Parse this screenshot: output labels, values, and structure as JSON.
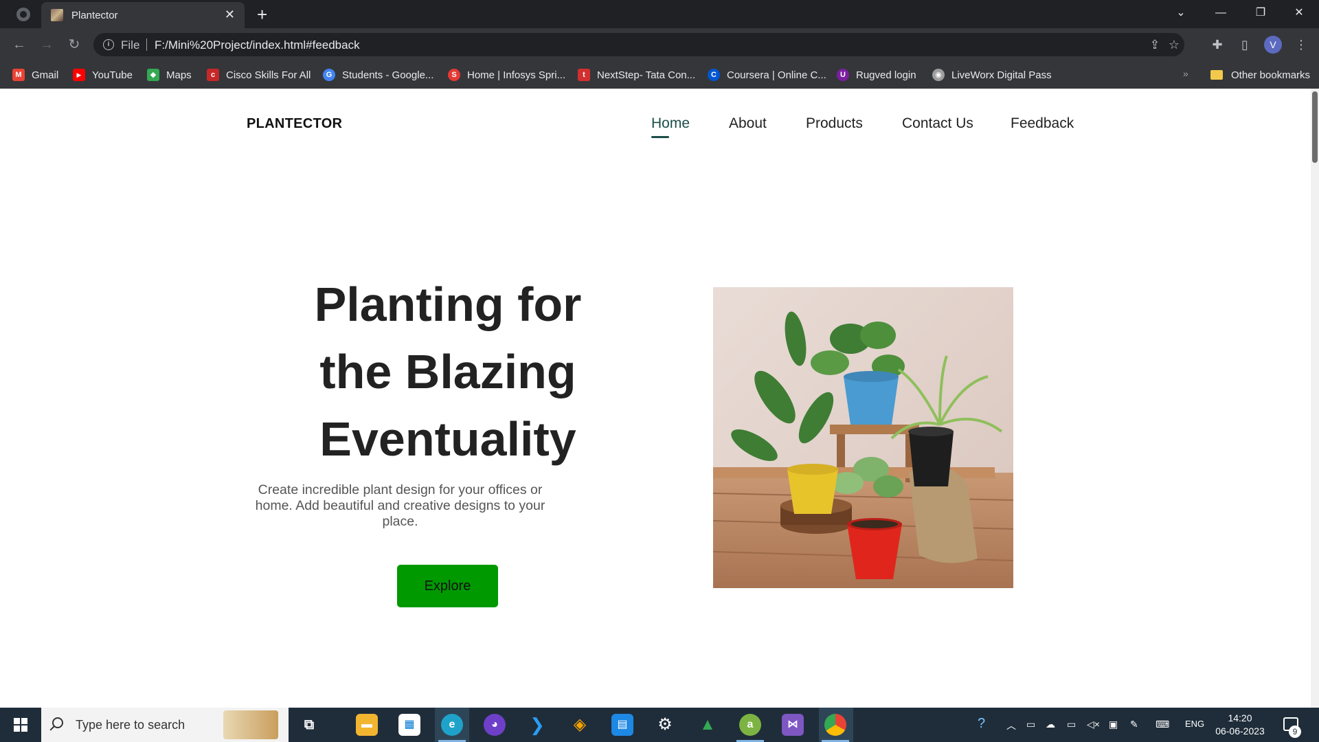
{
  "browser": {
    "tab_title": "Plantector",
    "file_label": "File",
    "url": "F:/Mini%20Project/index.html#feedback",
    "profile_initial": "V"
  },
  "bookmarks": [
    {
      "label": "Gmail",
      "icon": "gmail-icon",
      "color": "#ea4335",
      "glyph": "M"
    },
    {
      "label": "YouTube",
      "icon": "youtube-icon",
      "color": "#ff0000",
      "glyph": "▶"
    },
    {
      "label": "Maps",
      "icon": "maps-icon",
      "color": "#34a853",
      "glyph": "◆"
    },
    {
      "label": "Cisco Skills For All",
      "icon": "cisco-icon",
      "color": "#c62828",
      "glyph": "c"
    },
    {
      "label": "Students - Google...",
      "icon": "google-icon",
      "color": "#4285f4",
      "glyph": "G"
    },
    {
      "label": "Home | Infosys Spri...",
      "icon": "infosys-icon",
      "color": "#e53935",
      "glyph": "S"
    },
    {
      "label": "NextStep- Tata Con...",
      "icon": "tcs-icon",
      "color": "#d32f2f",
      "glyph": "t"
    },
    {
      "label": "Coursera | Online C...",
      "icon": "coursera-icon",
      "color": "#0056d2",
      "glyph": "C"
    },
    {
      "label": "Rugved login",
      "icon": "rugved-icon",
      "color": "#7b1fa2",
      "glyph": "U"
    },
    {
      "label": "LiveWorx Digital Pass",
      "icon": "liveworx-icon",
      "color": "#9e9e9e",
      "glyph": "◉"
    }
  ],
  "other_bookmarks": "Other bookmarks",
  "site": {
    "logo": "PLANTECTOR",
    "nav": [
      "Home",
      "About",
      "Products",
      "Contact Us",
      "Feedback"
    ],
    "active_nav": "Home",
    "hero_title": "Planting for the Blazing Eventuality",
    "hero_subtitle": "Create incredible plant design for your offices or home. Add beautiful and creative designs to your place.",
    "cta": "Explore",
    "accent_color": "#1b4d4a",
    "cta_color": "#009900"
  },
  "taskbar": {
    "search_placeholder": "Type here to search",
    "language": "ENG",
    "time": "14:20",
    "date": "06-06-2023",
    "notification_count": "9"
  }
}
